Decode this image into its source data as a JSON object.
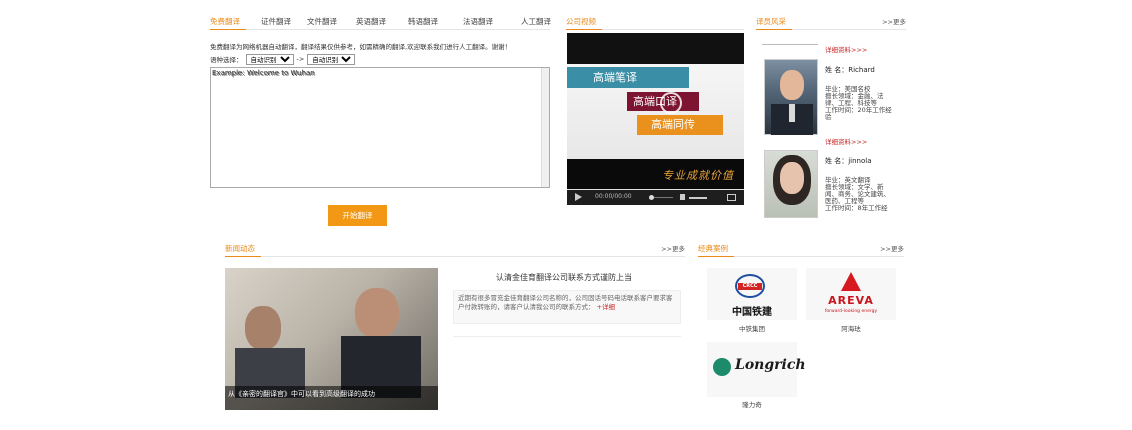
{
  "translate": {
    "tabs": [
      "免费翻译",
      "证件翻译",
      "文件翻译",
      "英语翻译",
      "韩语翻译",
      "法语翻译",
      "人工翻译"
    ],
    "notice": "免费翻译为网络机器自动翻译，翻译结果仅供参考，如需精确的翻译,欢迎联系我们进行人工翻译。谢谢！",
    "select_label": "语种选择：",
    "from_option": "自动识别",
    "arrow": "->",
    "to_option": "自动识别",
    "placeholder": "Example: Welcome to Wuhan",
    "submit_label": "开始翻译"
  },
  "video": {
    "title": "公司视频",
    "banner1": "高端笔译",
    "banner2": "高端口译",
    "banner3": "高端同传",
    "calligraphy": "专业成就价值",
    "time": "00:00/00:00"
  },
  "profiles": {
    "title": "译员风采",
    "more": ">>更多",
    "detail_link": "详细资料>>>",
    "items": [
      {
        "name": "姓 名：Richard",
        "lines": [
          "毕业：美国名校",
          "擅长领域：金融、法",
          "律、工程、科技等",
          "工作时间：20年工作经",
          "验"
        ]
      },
      {
        "name": "姓 名：jinnola",
        "lines": [
          "毕业：英文翻译",
          "擅长领域：文学、新",
          "闻、商务、论文建筑、",
          "医药、工程等",
          "工作时间：8年工作经"
        ]
      }
    ]
  },
  "news": {
    "title": "新闻动态",
    "more": ">>更多",
    "caption": "从《亲密的翻译官》中可以看到高级翻译的成功",
    "headline": "认清金佳育翻译公司联系方式谨防上当",
    "summary": "近期有很多冒充金佳育翻译公司名称的，公司固话号码电话联系客户要求客户付款转账的，请客户认清我公司的联系方式：",
    "detail": "+详细"
  },
  "cases": {
    "title": "经典案例",
    "more": ">>更多",
    "items": [
      {
        "logo_text": "中国铁建",
        "badge": "CRCC",
        "caption": "中铁集团"
      },
      {
        "logo_text": "AREVA",
        "sub": "forward-looking energy",
        "caption": "阿海珐"
      },
      {
        "logo_text": "Longrich",
        "caption": "隆力奇"
      }
    ]
  },
  "colors": {
    "accent": "#e98a1a",
    "button": "#f39814",
    "banner_teal": "#3a8fa6",
    "banner_maroon": "#7d1431",
    "banner_orange": "#e9911c"
  }
}
